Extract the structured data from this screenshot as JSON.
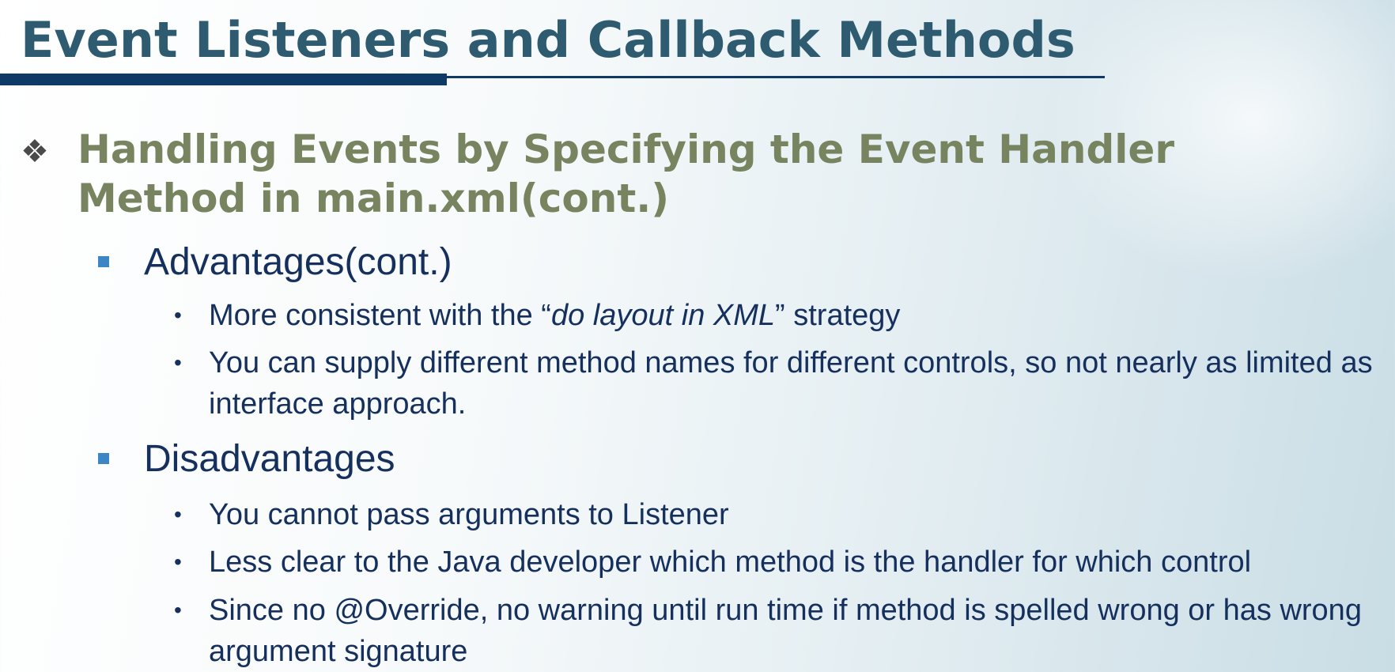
{
  "slide": {
    "title": "Event Listeners and Callback Methods",
    "heading": {
      "bullet": "❖",
      "text": "Handling Events by Specifying the Event Handler Method in main.xml(cont.)"
    },
    "advantages": {
      "label": "Advantages(cont.)",
      "items": [
        {
          "before": "More consistent with the “",
          "italic": "do layout in XML",
          "after": "” strategy"
        },
        {
          "text": "You can supply different method names for different controls, so not nearly as limited as interface approach."
        }
      ]
    },
    "disadvantages": {
      "label": "Disadvantages",
      "items": [
        {
          "text": "You cannot pass arguments to Listener"
        },
        {
          "text": "Less clear to the Java developer which method is the handler for which control"
        },
        {
          "text": "Since no @Override, no warning until run time if method is spelled wrong or has wrong argument signature"
        }
      ]
    },
    "bullet_char": "•",
    "colors": {
      "title": "#2e5b70",
      "heading": "#77845f",
      "body": "#16305e",
      "rule": "#0f3a66",
      "square_bullet": "#3d86c6"
    }
  }
}
